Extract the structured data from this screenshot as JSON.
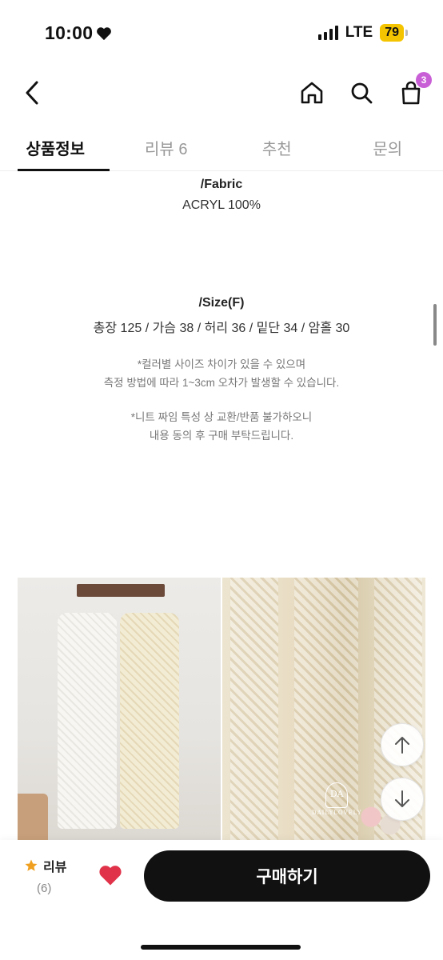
{
  "status": {
    "time": "10:00",
    "network": "LTE",
    "battery": "79"
  },
  "header": {
    "cart_count": "3"
  },
  "tabs": [
    {
      "label": "상품정보",
      "active": true
    },
    {
      "label": "리뷰 6",
      "active": false
    },
    {
      "label": "추천",
      "active": false
    },
    {
      "label": "문의",
      "active": false
    }
  ],
  "details": {
    "fabric_title": "/Fabric",
    "fabric_value": "ACRYL 100%",
    "size_title": "/Size(F)",
    "size_value": "총장 125 / 가슴 38 / 허리 36 / 밑단 34 / 암홀 30",
    "note1": "*컬러별 사이즈 차이가 있을 수 있으며",
    "note2": "측정 방법에 따라 1~3cm 오차가 발생할 수 있습니다.",
    "note3": "*니트 짜임 특성 상 교환/반품 불가하오니",
    "note4": "내용 동의 후 구매 부탁드립니다."
  },
  "bottom": {
    "review_label": "리뷰",
    "review_count": "(6)",
    "buy_label": "구매하기"
  },
  "icons": {
    "back": "chevron-left-icon",
    "home": "home-icon",
    "search": "search-icon",
    "cart": "shopping-bag-icon",
    "up": "arrow-up-icon",
    "down": "arrow-down-icon",
    "star": "star-icon",
    "heart": "heart-icon"
  },
  "colors": {
    "accent": "#111111",
    "heart": "#e0334a",
    "star": "#f0a020",
    "badge": "#c95fd6",
    "battery": "#f5c400"
  }
}
